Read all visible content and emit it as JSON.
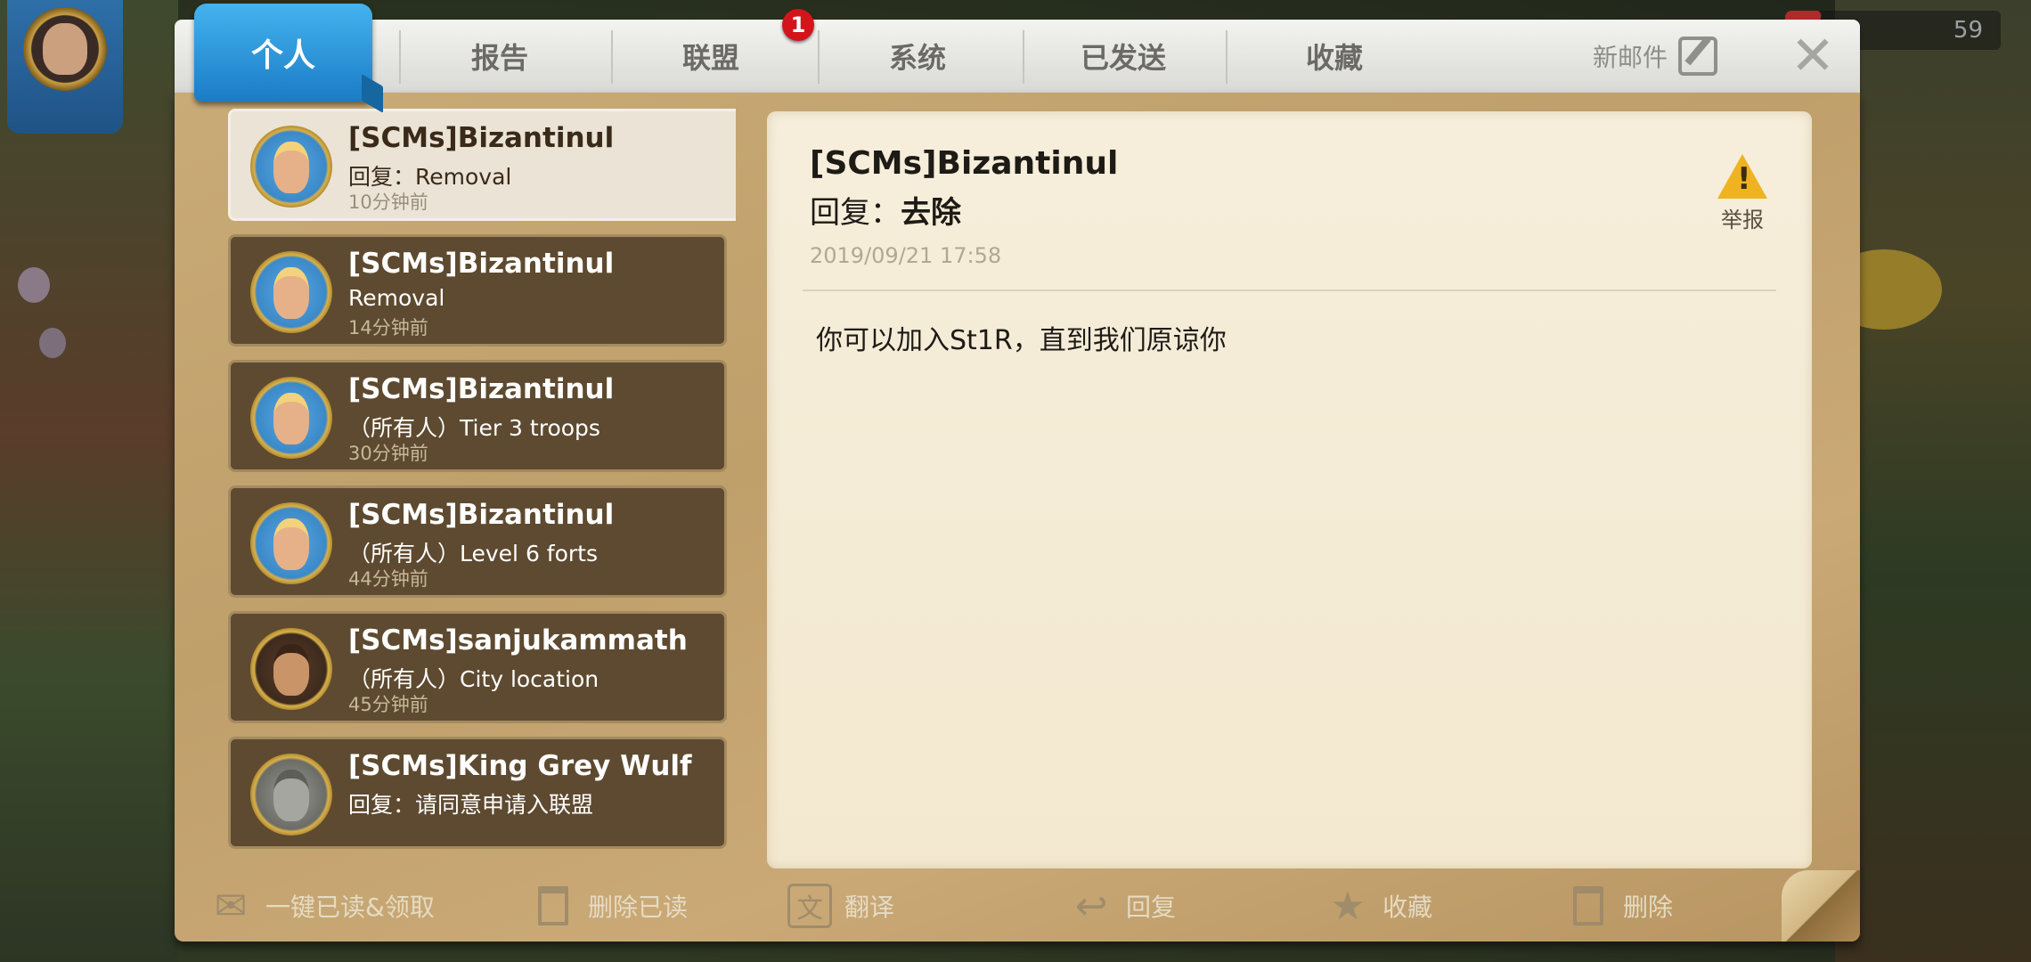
{
  "header": {
    "resource_count": "59"
  },
  "tabs": [
    {
      "label": "个人",
      "active": true
    },
    {
      "label": "报告"
    },
    {
      "label": "联盟",
      "badge": "1"
    },
    {
      "label": "系统"
    },
    {
      "label": "已发送"
    },
    {
      "label": "收藏"
    }
  ],
  "toolbar": {
    "new_mail_label": "新邮件",
    "close_icon": "close-icon"
  },
  "mail_list": [
    {
      "sender": "[SCMs]Bizantinul",
      "subject": "回复：Removal",
      "time": "10分钟前",
      "avatar": "blonde-warrior",
      "selected": true
    },
    {
      "sender": "[SCMs]Bizantinul",
      "subject": "Removal",
      "time": "14分钟前",
      "avatar": "blonde-warrior"
    },
    {
      "sender": "[SCMs]Bizantinul",
      "subject": "（所有人）Tier 3 troops",
      "time": "30分钟前",
      "avatar": "blonde-warrior"
    },
    {
      "sender": "[SCMs]Bizantinul",
      "subject": "（所有人）Level 6 forts",
      "time": "44分钟前",
      "avatar": "blonde-warrior"
    },
    {
      "sender": "[SCMs]sanjukammath",
      "subject": "（所有人）City location",
      "time": "45分钟前",
      "avatar": "bearded-king"
    },
    {
      "sender": "[SCMs]King Grey Wulf",
      "subject": "回复：请同意申请入联盟",
      "time": "",
      "avatar": "grey-wolf"
    }
  ],
  "detail": {
    "sender": "[SCMs]Bizantinul",
    "subject_prefix": "回复：",
    "subject": "去除",
    "date": "2019/09/21 17:58",
    "body": "你可以加入St1R，直到我们原谅你",
    "report_label": "举报"
  },
  "bottom_bar": {
    "read_all_label": "一键已读&领取",
    "delete_read_label": "删除已读",
    "translate_label": "翻译",
    "reply_label": "回复",
    "favorite_label": "收藏",
    "delete_label": "删除"
  },
  "colors": {
    "active_tab": "#1f8fd8",
    "badge": "#d3151b",
    "parchment": "#c9ab77",
    "list_item": "#5e4a30",
    "warning": "#efb321"
  }
}
